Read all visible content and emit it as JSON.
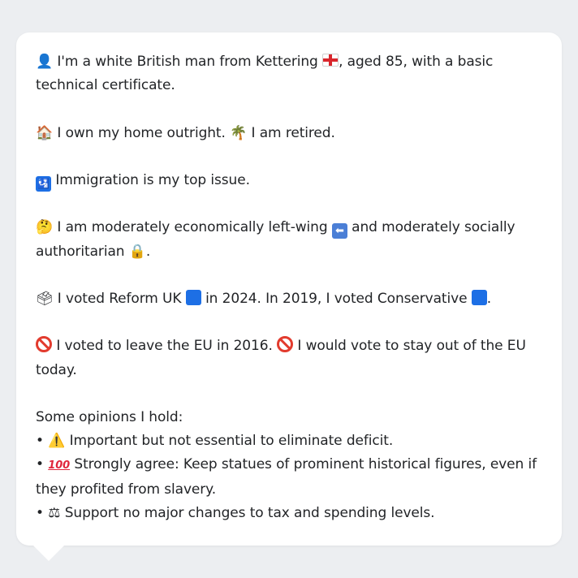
{
  "message": {
    "p1": {
      "icon": "bust-in-silhouette-icon",
      "text_before": "I'm a white British man from Kettering",
      "flag": "england-flag-icon",
      "text_after": ", aged 85, with a basic technical certificate."
    },
    "p2": {
      "icon1": "house-icon",
      "text1": "I own my home outright.",
      "icon2": "palm-tree-icon",
      "text2": "I am retired."
    },
    "p3": {
      "icon": "passport-control-icon",
      "text": "Immigration is my top issue."
    },
    "p4": {
      "icon": "thinking-face-icon",
      "text1": "I am moderately economically left-wing",
      "arrow": "left-arrow-icon",
      "text2": "and moderately socially authoritarian",
      "lock": "lock-icon",
      "text3": "."
    },
    "p5": {
      "icon": "ballot-box-icon",
      "text1": "I voted Reform UK",
      "text2": "in 2024. In 2019, I voted Conservative",
      "text3": ".",
      "reform_color": "#1d6fe5",
      "conservative_color": "#1d6fe5"
    },
    "p6": {
      "icon": "prohibited-icon",
      "text1": "I voted to leave the EU in 2016.",
      "text2": "I would vote to stay out of the EU today."
    },
    "opinions": {
      "heading": "Some opinions I hold:",
      "items": [
        {
          "bullet": "•",
          "icon": "warning-icon",
          "text": "Important but not essential to eliminate deficit."
        },
        {
          "bullet": "•",
          "icon": "hundred-points-icon",
          "text": "Strongly agree: Keep statues of prominent historical figures, even if they profited from slavery."
        },
        {
          "bullet": "•",
          "icon": "balance-scale-icon",
          "text": "Support no major changes to tax and spending levels."
        }
      ]
    }
  }
}
